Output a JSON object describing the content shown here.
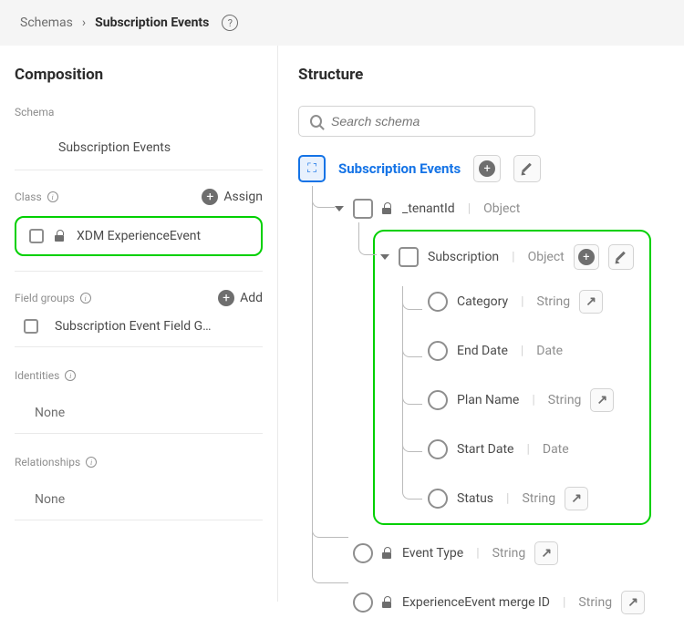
{
  "header": {
    "breadcrumb_root": "Schemas",
    "breadcrumb_current": "Subscription Events"
  },
  "sidebar": {
    "title": "Composition",
    "schema_label": "Schema",
    "schema_name": "Subscription Events",
    "class_label": "Class",
    "assign_label": "Assign",
    "class_name": "XDM ExperienceEvent",
    "fg_label": "Field groups",
    "add_label": "Add",
    "fg_item": "Subscription Event Field G…",
    "identities_label": "Identities",
    "none": "None",
    "relationships_label": "Relationships"
  },
  "structure": {
    "title": "Structure",
    "search_placeholder": "Search schema",
    "root_name": "Subscription Events",
    "tenant_name": "_tenantId",
    "tenant_type": "Object",
    "subscription_name": "Subscription",
    "subscription_type": "Object",
    "fields": {
      "category_name": "Category",
      "category_type": "String",
      "enddate_name": "End Date",
      "enddate_type": "Date",
      "planname_name": "Plan Name",
      "planname_type": "String",
      "startdate_name": "Start Date",
      "startdate_type": "Date",
      "status_name": "Status",
      "status_type": "String"
    },
    "eventtype_name": "Event Type",
    "eventtype_type": "String",
    "mergeid_name": "ExperienceEvent merge ID",
    "mergeid_type": "String"
  }
}
